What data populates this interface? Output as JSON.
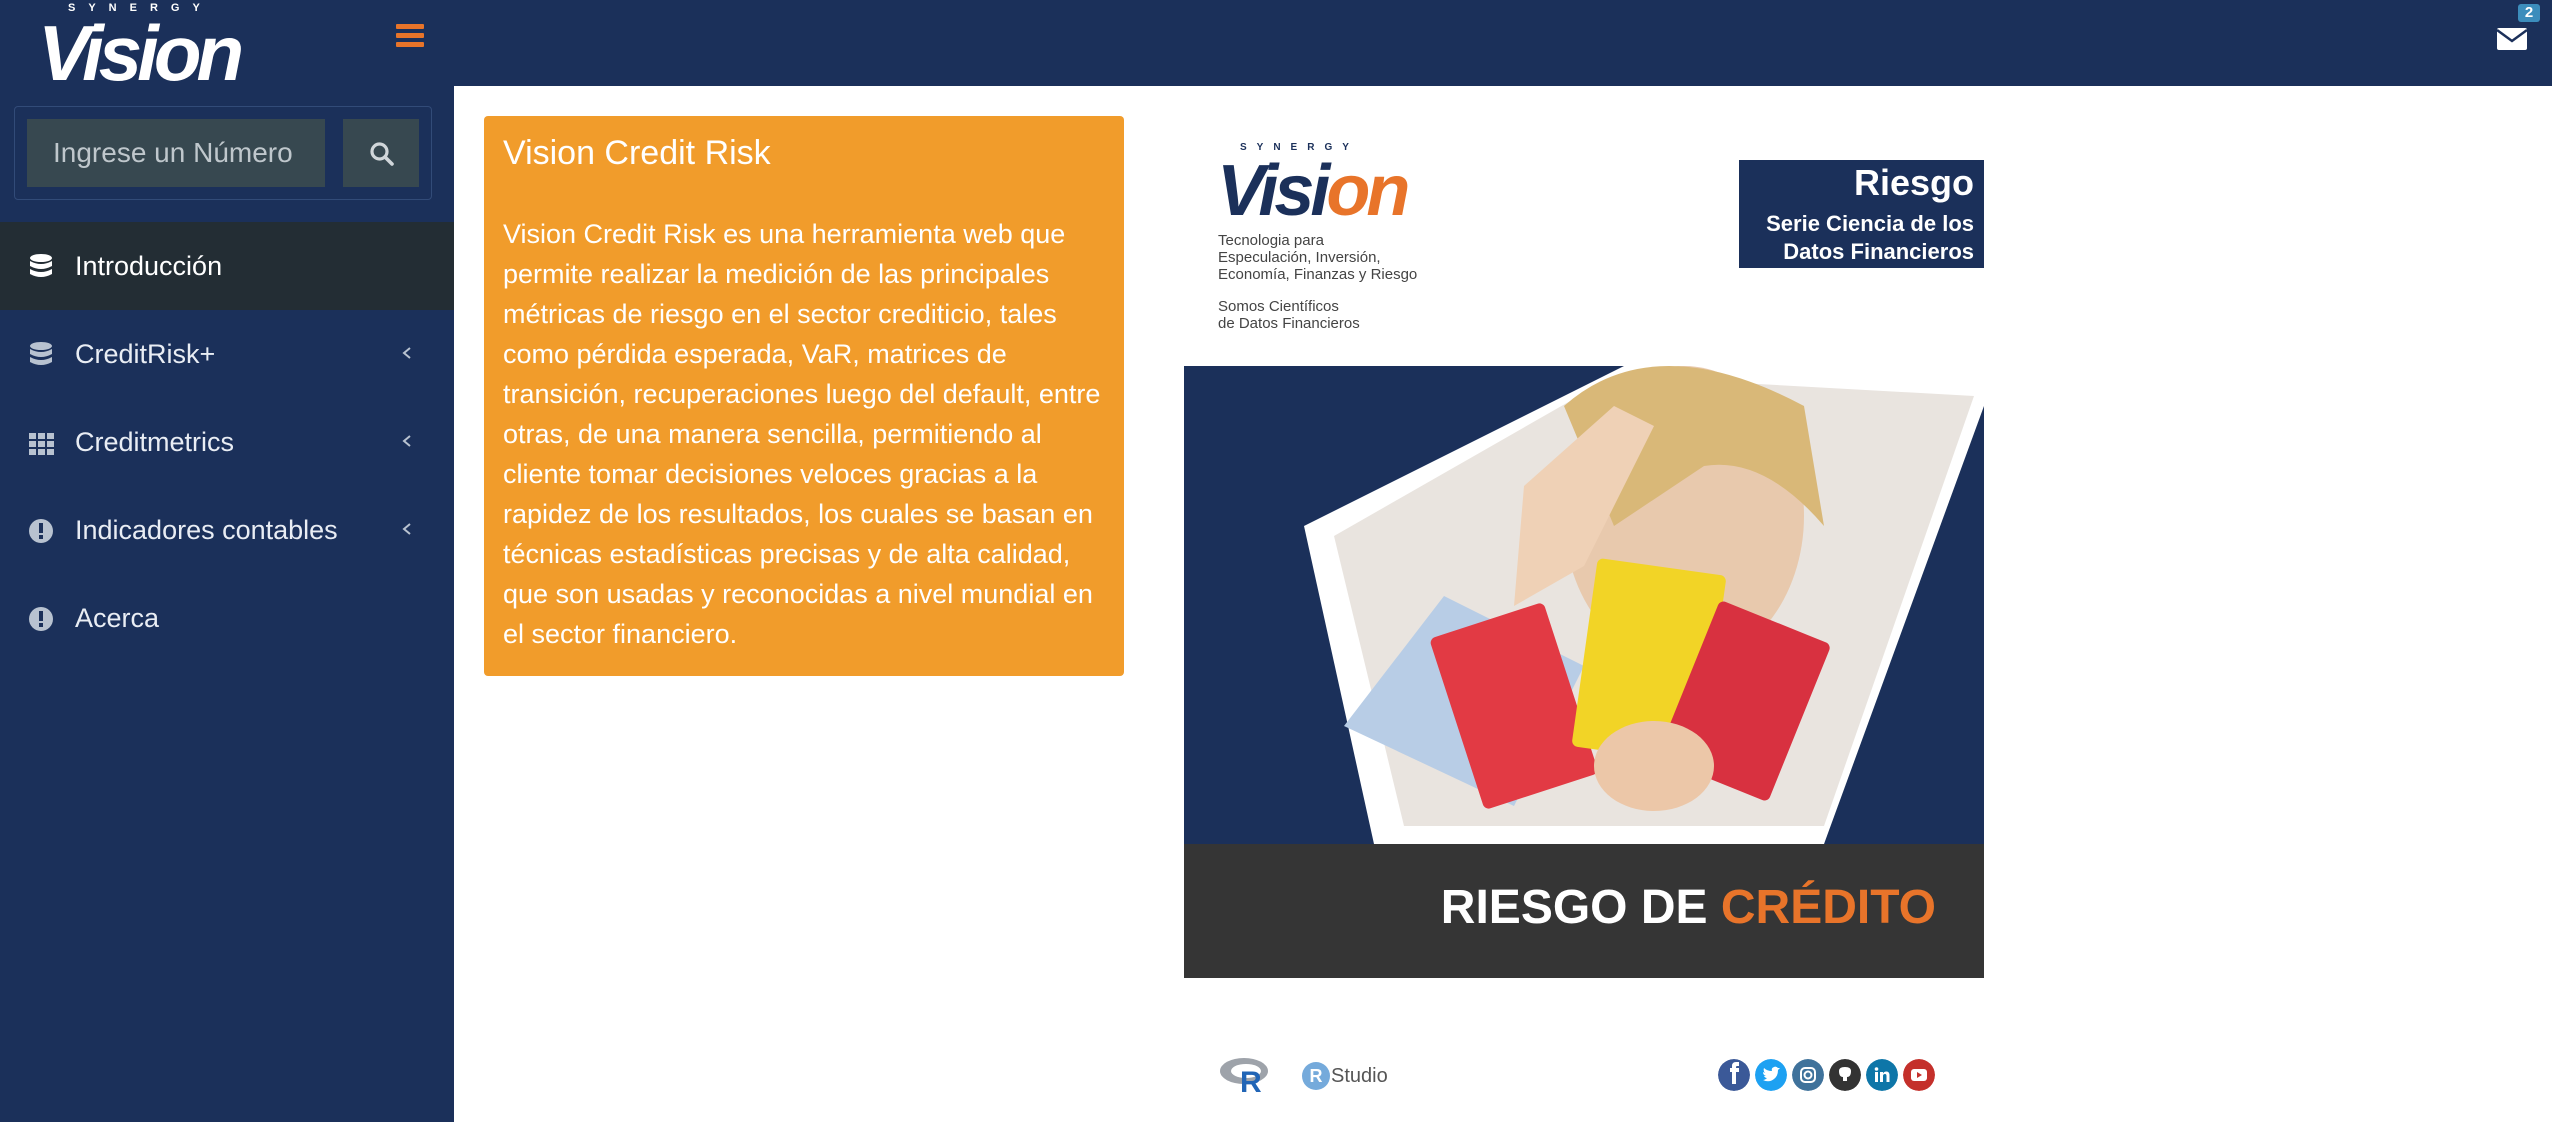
{
  "brand": {
    "small": "SYNERGY",
    "name": "Vision"
  },
  "header": {
    "mail_badge_count": "2"
  },
  "sidebar": {
    "search": {
      "placeholder": "Ingrese un Número"
    },
    "items": [
      {
        "label": "Introducción",
        "icon": "database-icon",
        "active": true,
        "has_submenu": false
      },
      {
        "label": "CreditRisk+",
        "icon": "database-icon",
        "active": false,
        "has_submenu": true
      },
      {
        "label": "Creditmetrics",
        "icon": "grid-icon",
        "active": false,
        "has_submenu": true
      },
      {
        "label": "Indicadores contables",
        "icon": "exclamation-circle-icon",
        "active": false,
        "has_submenu": true
      },
      {
        "label": "Acerca",
        "icon": "exclamation-circle-icon",
        "active": false,
        "has_submenu": false
      }
    ]
  },
  "card": {
    "title": "Vision Credit Risk",
    "body": "Vision Credit Risk es una herramienta web que permite realizar la medición de las principales métricas de riesgo en el sector crediticio, tales como pérdida esperada, VaR, matrices de transición, recuperaciones luego del default, entre otras, de una manera sencilla, permitiendo al cliente tomar decisiones veloces gracias a la rapidez de los resultados, los cuales se basan en técnicas estadísticas precisas y de alta calidad, que son usadas y reconocidas a nivel mundial en el sector financiero."
  },
  "poster": {
    "logo_small": "SYNERGY",
    "logo_a": "Visi",
    "logo_b": "on",
    "tagline_1": "Tecnologia para",
    "tagline_2": "Especulación, Inversión,",
    "tagline_3": "Economía, Finanzas y Riesgo",
    "tagline_4": "Somos Científicos",
    "tagline_5": "de Datos Financieros",
    "badge_title": "Riesgo",
    "badge_line1": "Serie Ciencia de los",
    "badge_line2": "Datos Financieros",
    "banner_a": "RIESGO DE ",
    "banner_b": "CRÉDITO"
  },
  "footer": {
    "r_label": "R",
    "rstudio_badge": "R",
    "rstudio_label": "Studio",
    "socials": [
      "facebook-icon",
      "twitter-icon",
      "instagram-icon",
      "github-icon",
      "linkedin-icon",
      "youtube-icon"
    ]
  },
  "colors": {
    "header_bg": "#1b305a",
    "accent_orange": "#e8742a",
    "card_orange": "#f19c2b",
    "sidebar_active": "#232d34"
  }
}
